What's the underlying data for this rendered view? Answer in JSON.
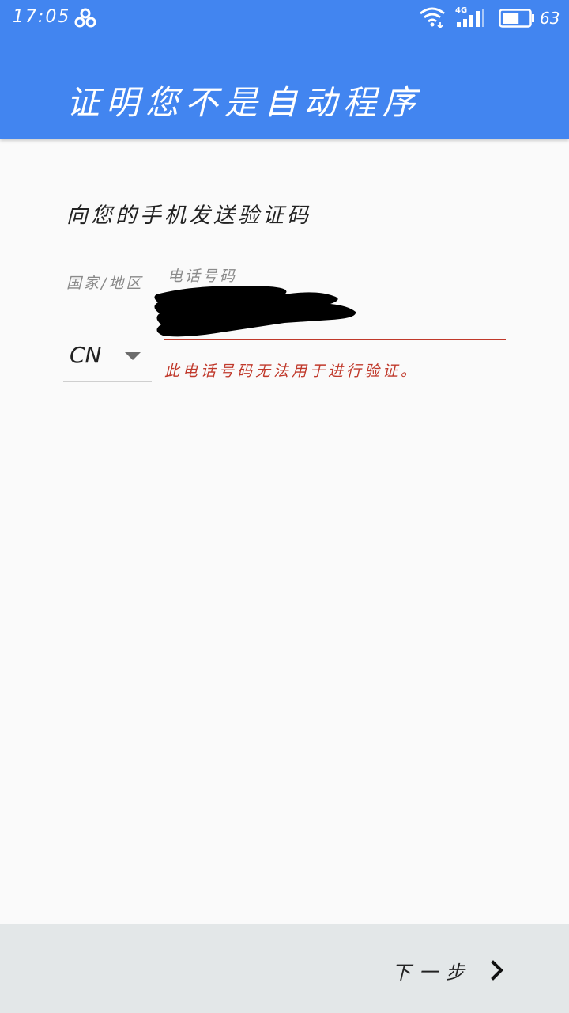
{
  "status_bar": {
    "time": "17:05",
    "network": "4G",
    "battery_level": "63",
    "battery_fraction": 0.63
  },
  "app_bar": {
    "title": "证明您不是自动程序"
  },
  "form": {
    "prompt": "向您的手机发送验证码",
    "country_label": "国家/地区",
    "phone_label": "电话号码",
    "country_value": "CN",
    "phone_value": "",
    "error": "此电话号码无法用于进行验证。"
  },
  "bottom_bar": {
    "next_label": "下一步"
  },
  "colors": {
    "primary": "#4285f0",
    "error": "#c0392b",
    "bottom_bar": "#e3e7e8"
  }
}
